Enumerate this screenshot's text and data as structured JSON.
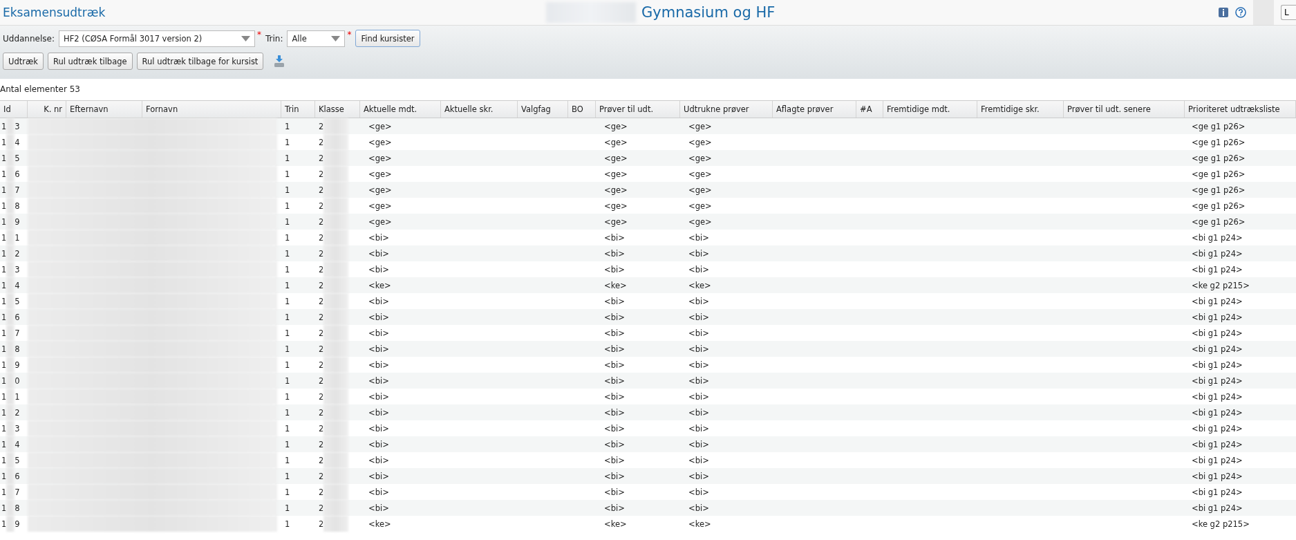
{
  "page_title": "Eksamensudtræk",
  "school_name": "Gymnasium og HF",
  "user_button": "L",
  "filters": {
    "education_label": "Uddannelse:",
    "education_value": "HF2 (CØSA Formål 3017 version 2)",
    "required_mark": "*",
    "level_label": "Trin:",
    "level_value": "Alle",
    "level_required_mark": "*",
    "find_button": "Find kursister"
  },
  "actions": [
    "Udtræk",
    "Rul udtræk tilbage",
    "Rul udtræk tilbage for kursist"
  ],
  "count_text": "Antal elementer 53",
  "table": {
    "columns": [
      "Id",
      "K. nr",
      "Efternavn",
      "Fornavn",
      "Trin",
      "Klasse",
      "Aktuelle mdt.",
      "Aktuelle skr.",
      "Valgfag",
      "BO",
      "Prøver til udt.",
      "Udtrukne prøver",
      "Aflagte prøver",
      "#A",
      "Fremtidige mdt.",
      "Fremtidige skr.",
      "Prøver til udt. senere",
      "Prioriteret udtræksliste"
    ],
    "rows": [
      {
        "id_first": "1",
        "id_last": "3",
        "trin": "1",
        "klasse": "2",
        "aktuelle_mdt": "<ge>",
        "prover_til_udt": "<ge>",
        "udtrukne": "<ge>",
        "prioriteret": "<ge g1 p26>"
      },
      {
        "id_first": "1",
        "id_last": "4",
        "trin": "1",
        "klasse": "2",
        "aktuelle_mdt": "<ge>",
        "prover_til_udt": "<ge>",
        "udtrukne": "<ge>",
        "prioriteret": "<ge g1 p26>"
      },
      {
        "id_first": "1",
        "id_last": "5",
        "trin": "1",
        "klasse": "2",
        "aktuelle_mdt": "<ge>",
        "prover_til_udt": "<ge>",
        "udtrukne": "<ge>",
        "prioriteret": "<ge g1 p26>"
      },
      {
        "id_first": "1",
        "id_last": "6",
        "trin": "1",
        "klasse": "2",
        "aktuelle_mdt": "<ge>",
        "prover_til_udt": "<ge>",
        "udtrukne": "<ge>",
        "prioriteret": "<ge g1 p26>"
      },
      {
        "id_first": "1",
        "id_last": "7",
        "trin": "1",
        "klasse": "2",
        "aktuelle_mdt": "<ge>",
        "prover_til_udt": "<ge>",
        "udtrukne": "<ge>",
        "prioriteret": "<ge g1 p26>"
      },
      {
        "id_first": "1",
        "id_last": "8",
        "trin": "1",
        "klasse": "2",
        "aktuelle_mdt": "<ge>",
        "prover_til_udt": "<ge>",
        "udtrukne": "<ge>",
        "prioriteret": "<ge g1 p26>"
      },
      {
        "id_first": "1",
        "id_last": "9",
        "trin": "1",
        "klasse": "2",
        "aktuelle_mdt": "<ge>",
        "prover_til_udt": "<ge>",
        "udtrukne": "<ge>",
        "prioriteret": "<ge g1 p26>"
      },
      {
        "id_first": "1",
        "id_last": "1",
        "trin": "1",
        "klasse": "2",
        "aktuelle_mdt": "<bi>",
        "prover_til_udt": "<bi>",
        "udtrukne": "<bi>",
        "prioriteret": "<bi g1 p24>"
      },
      {
        "id_first": "1",
        "id_last": "2",
        "trin": "1",
        "klasse": "2",
        "aktuelle_mdt": "<bi>",
        "prover_til_udt": "<bi>",
        "udtrukne": "<bi>",
        "prioriteret": "<bi g1 p24>"
      },
      {
        "id_first": "1",
        "id_last": "3",
        "trin": "1",
        "klasse": "2",
        "aktuelle_mdt": "<bi>",
        "prover_til_udt": "<bi>",
        "udtrukne": "<bi>",
        "prioriteret": "<bi g1 p24>"
      },
      {
        "id_first": "1",
        "id_last": "4",
        "trin": "1",
        "klasse": "2",
        "aktuelle_mdt": "<ke>",
        "prover_til_udt": "<ke>",
        "udtrukne": "<ke>",
        "prioriteret": "<ke g2 p215>"
      },
      {
        "id_first": "1",
        "id_last": "5",
        "trin": "1",
        "klasse": "2",
        "aktuelle_mdt": "<bi>",
        "prover_til_udt": "<bi>",
        "udtrukne": "<bi>",
        "prioriteret": "<bi g1 p24>"
      },
      {
        "id_first": "1",
        "id_last": "6",
        "trin": "1",
        "klasse": "2",
        "aktuelle_mdt": "<bi>",
        "prover_til_udt": "<bi>",
        "udtrukne": "<bi>",
        "prioriteret": "<bi g1 p24>"
      },
      {
        "id_first": "1",
        "id_last": "7",
        "trin": "1",
        "klasse": "2",
        "aktuelle_mdt": "<bi>",
        "prover_til_udt": "<bi>",
        "udtrukne": "<bi>",
        "prioriteret": "<bi g1 p24>"
      },
      {
        "id_first": "1",
        "id_last": "8",
        "trin": "1",
        "klasse": "2",
        "aktuelle_mdt": "<bi>",
        "prover_til_udt": "<bi>",
        "udtrukne": "<bi>",
        "prioriteret": "<bi g1 p24>"
      },
      {
        "id_first": "1",
        "id_last": "9",
        "trin": "1",
        "klasse": "2",
        "aktuelle_mdt": "<bi>",
        "prover_til_udt": "<bi>",
        "udtrukne": "<bi>",
        "prioriteret": "<bi g1 p24>"
      },
      {
        "id_first": "1",
        "id_last": "0",
        "trin": "1",
        "klasse": "2",
        "aktuelle_mdt": "<bi>",
        "prover_til_udt": "<bi>",
        "udtrukne": "<bi>",
        "prioriteret": "<bi g1 p24>"
      },
      {
        "id_first": "1",
        "id_last": "1",
        "trin": "1",
        "klasse": "2",
        "aktuelle_mdt": "<bi>",
        "prover_til_udt": "<bi>",
        "udtrukne": "<bi>",
        "prioriteret": "<bi g1 p24>"
      },
      {
        "id_first": "1",
        "id_last": "2",
        "trin": "1",
        "klasse": "2",
        "aktuelle_mdt": "<bi>",
        "prover_til_udt": "<bi>",
        "udtrukne": "<bi>",
        "prioriteret": "<bi g1 p24>"
      },
      {
        "id_first": "1",
        "id_last": "3",
        "trin": "1",
        "klasse": "2",
        "aktuelle_mdt": "<bi>",
        "prover_til_udt": "<bi>",
        "udtrukne": "<bi>",
        "prioriteret": "<bi g1 p24>"
      },
      {
        "id_first": "1",
        "id_last": "4",
        "trin": "1",
        "klasse": "2",
        "aktuelle_mdt": "<bi>",
        "prover_til_udt": "<bi>",
        "udtrukne": "<bi>",
        "prioriteret": "<bi g1 p24>"
      },
      {
        "id_first": "1",
        "id_last": "5",
        "trin": "1",
        "klasse": "2",
        "aktuelle_mdt": "<bi>",
        "prover_til_udt": "<bi>",
        "udtrukne": "<bi>",
        "prioriteret": "<bi g1 p24>"
      },
      {
        "id_first": "1",
        "id_last": "6",
        "trin": "1",
        "klasse": "2",
        "aktuelle_mdt": "<bi>",
        "prover_til_udt": "<bi>",
        "udtrukne": "<bi>",
        "prioriteret": "<bi g1 p24>"
      },
      {
        "id_first": "1",
        "id_last": "7",
        "trin": "1",
        "klasse": "2",
        "aktuelle_mdt": "<bi>",
        "prover_til_udt": "<bi>",
        "udtrukne": "<bi>",
        "prioriteret": "<bi g1 p24>"
      },
      {
        "id_first": "1",
        "id_last": "8",
        "trin": "1",
        "klasse": "2",
        "aktuelle_mdt": "<bi>",
        "prover_til_udt": "<bi>",
        "udtrukne": "<bi>",
        "prioriteret": "<bi g1 p24>"
      },
      {
        "id_first": "1",
        "id_last": "9",
        "trin": "1",
        "klasse": "2",
        "aktuelle_mdt": "<ke>",
        "prover_til_udt": "<ke>",
        "udtrukne": "<ke>",
        "prioriteret": "<ke g2 p215>"
      }
    ]
  }
}
